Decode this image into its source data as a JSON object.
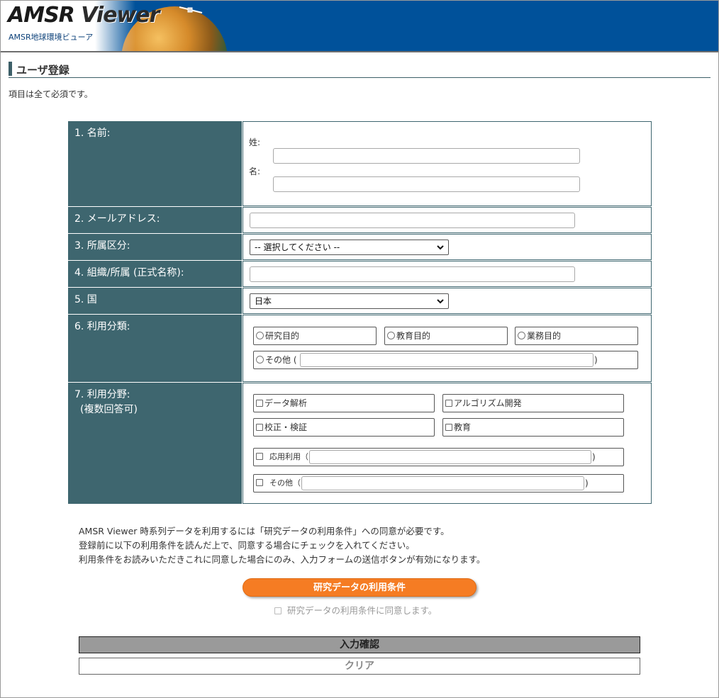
{
  "header": {
    "logo_text_a": "AMSR",
    "logo_text_b": "Viewer",
    "logo_subtitle": "AMSR地球環境ビューア",
    "header_color": "#00519a"
  },
  "page": {
    "title": "ユーザ登録",
    "required_note": "項目は全て必須です。"
  },
  "form": {
    "name": {
      "label": "1. 名前:",
      "last_name_label": "姓:",
      "first_name_label": "名:",
      "last_name_value": "",
      "first_name_value": ""
    },
    "email": {
      "label": "2. メールアドレス:",
      "value": ""
    },
    "affiliation_type": {
      "label": "3. 所属区分:",
      "selected": "-- 選択してください --"
    },
    "organization": {
      "label": "4. 組織/所属 (正式名称):",
      "value": ""
    },
    "country": {
      "label": "5. 国",
      "selected": "日本"
    },
    "usage_type": {
      "label": "6. 利用分類:",
      "options": [
        "研究目的",
        "教育目的",
        "業務目的"
      ],
      "other_label": "その他 (",
      "other_close": ")",
      "other_value": ""
    },
    "usage_field": {
      "label_line1": "7. 利用分野:",
      "label_line2": "(複数回答可)",
      "options": [
        "データ解析",
        "アルゴリズム開発",
        "校正・検証",
        "教育"
      ],
      "applied_label": "応用利用（",
      "applied_close": ")",
      "applied_value": "",
      "other_label": "その他（",
      "other_close": ")",
      "other_value": ""
    }
  },
  "terms": {
    "line1": "AMSR Viewer 時系列データを利用するには「研究データの利用条件」への同意が必要です。",
    "line2": "登録前に以下の利用条件を読んだ上で、同意する場合にチェックを入れてください。",
    "line3": "利用条件をお読みいただきこれに同意した場合にのみ、入力フォームの送信ボタンが有効になります。",
    "button_label": "研究データの利用条件",
    "agree_label": "研究データの利用条件に同意します。",
    "button_color": "#f57c23"
  },
  "actions": {
    "confirm_label": "入力確認",
    "clear_label": "クリア"
  },
  "colors": {
    "label_bg": "#3e666f"
  }
}
